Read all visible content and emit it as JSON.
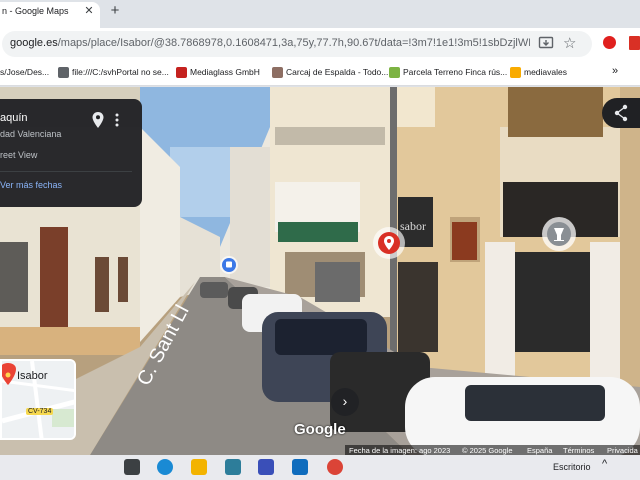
{
  "browser": {
    "tab_title": "n - Google Maps",
    "tab_close": "✕",
    "new_tab": "+",
    "url_host": "google.es",
    "url_path": "/maps/place/Isabor/@38.7868978,0.1608471,3a,75y,77.7h,90.67t/data=!3m7!1e1!3m5!1sbDzjlWD..."
  },
  "bookmarks": [
    {
      "label": "s/Jose/Des...",
      "color": "#9aa0a6"
    },
    {
      "label": "file:///C:/svhPortal no se...",
      "color": "#5f6368"
    },
    {
      "label": "Mediaglass GmbH",
      "color": "#c5221f"
    },
    {
      "label": "Carcaj de Espalda - Todo...",
      "color": "#8d6e63"
    },
    {
      "label": "Parcela Terreno Finca rús...",
      "color": "#7cb342"
    },
    {
      "label": "mediavales",
      "color": "#f9ab00"
    }
  ],
  "bookmarks_more": "»",
  "info_card": {
    "place_name": "aquín",
    "region": "dad Valenciana",
    "mode": "reet View",
    "more_dates": "Ver más fechas"
  },
  "minimap": {
    "label": "Isabor",
    "road_label": "CV-734"
  },
  "street_sign": "C. Sant Ll",
  "storefront_sign": "sabor",
  "logo_text": "Google",
  "attribution": {
    "date": "Fecha de la imagen: ago 2023",
    "copyright": "© 2025 Google",
    "country": "España",
    "terms": "Términos",
    "privacy": "Privacida"
  },
  "taskbar": {
    "escritorio": "Escritorio",
    "chevron": "^",
    "icons": [
      {
        "name": "task-view-icon",
        "color": "#3c4043"
      },
      {
        "name": "edge-icon",
        "color": "#1a8ad4"
      },
      {
        "name": "file-explorer-icon",
        "color": "#f3b300"
      },
      {
        "name": "store-icon",
        "color": "#2d7d9a"
      },
      {
        "name": "pro-app-icon",
        "color": "#3a4fb8"
      },
      {
        "name": "outlook-icon",
        "color": "#0f6cbd"
      },
      {
        "name": "chrome-icon",
        "color": "#db4437"
      }
    ]
  },
  "colors": {
    "accent_link": "#8ab4f8",
    "marker_red": "#d93025",
    "road_shield": "#f6d84f"
  }
}
